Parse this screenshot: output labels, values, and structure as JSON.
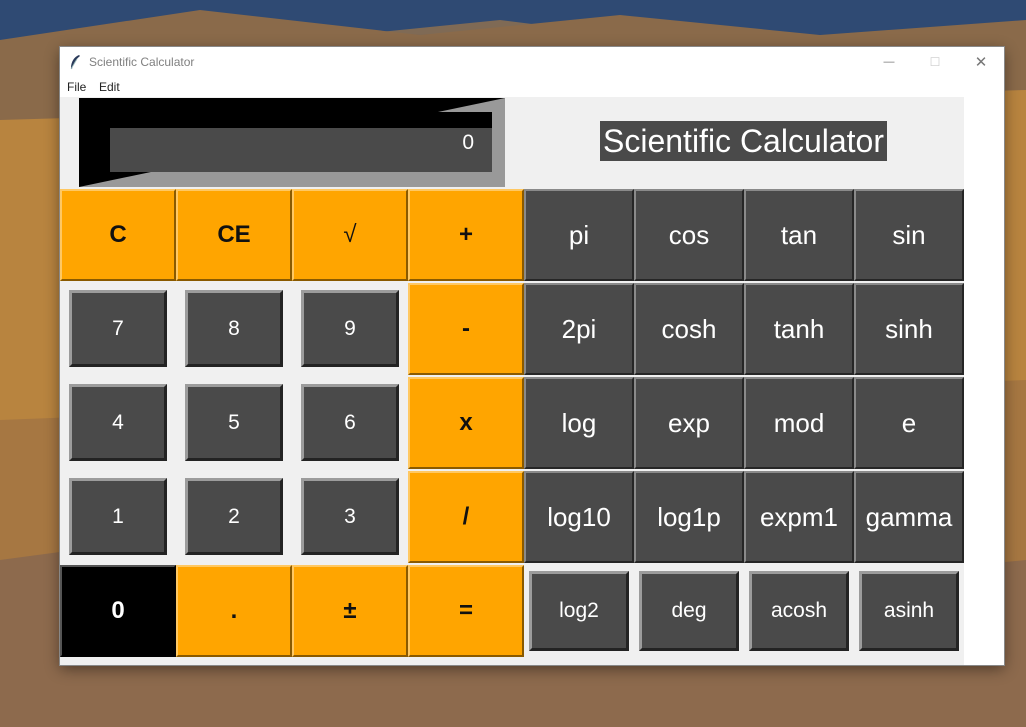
{
  "window": {
    "title": "Scientific Calculator",
    "controls": {
      "minimize": "—",
      "maximize": "☐",
      "close": "✕"
    }
  },
  "menu": [
    "File",
    "Edit"
  ],
  "display": {
    "value": "0"
  },
  "heading": "Scientific Calculator",
  "buttons": {
    "clear": "C",
    "clear_entry": "CE",
    "sqrt": "√",
    "add": "+",
    "subtract": "-",
    "multiply": "x",
    "divide": "/",
    "equals": "=",
    "decimal": ".",
    "plus_minus": "±",
    "digits": [
      "0",
      "1",
      "2",
      "3",
      "4",
      "5",
      "6",
      "7",
      "8",
      "9"
    ],
    "scientific": {
      "pi": "pi",
      "cos": "cos",
      "tan": "tan",
      "sin": "sin",
      "two_pi": "2pi",
      "cosh": "cosh",
      "tanh": "tanh",
      "sinh": "sinh",
      "log": "log",
      "exp": "exp",
      "mod": "mod",
      "e": "e",
      "log10": "log10",
      "log1p": "log1p",
      "expm1": "expm1",
      "gamma": "gamma",
      "log2": "log2",
      "deg": "deg",
      "acosh": "acosh",
      "asinh": "asinh"
    }
  },
  "colors": {
    "accent": "#ffa500",
    "button_gray": "#4a4a4a",
    "zero_button": "#000000",
    "background": "#f0f0f0"
  }
}
